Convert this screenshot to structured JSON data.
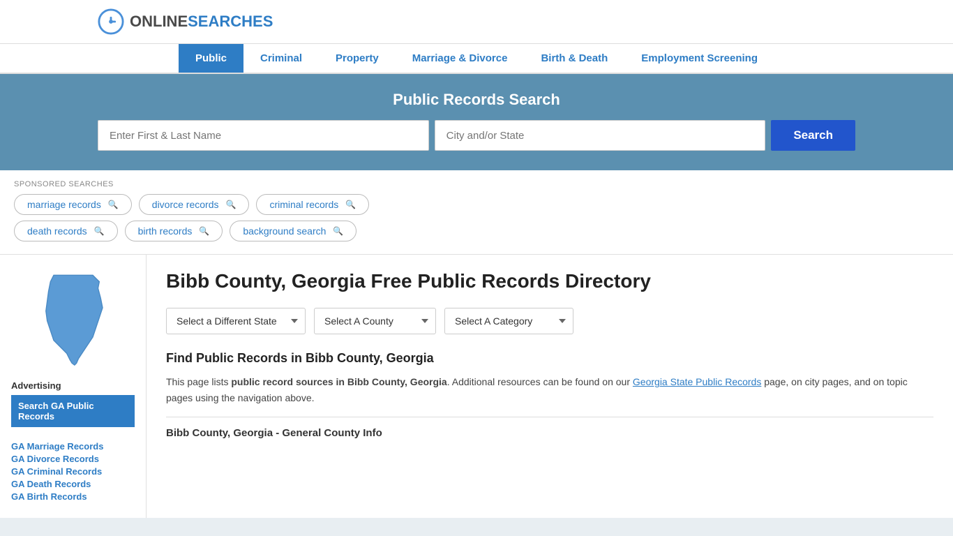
{
  "site": {
    "logo_online": "ONLINE",
    "logo_searches": "SEARCHES"
  },
  "nav": {
    "items": [
      {
        "label": "Public",
        "active": true
      },
      {
        "label": "Criminal",
        "active": false
      },
      {
        "label": "Property",
        "active": false
      },
      {
        "label": "Marriage & Divorce",
        "active": false
      },
      {
        "label": "Birth & Death",
        "active": false
      },
      {
        "label": "Employment Screening",
        "active": false
      }
    ]
  },
  "search_banner": {
    "title": "Public Records Search",
    "name_placeholder": "Enter First & Last Name",
    "location_placeholder": "City and/or State",
    "button_label": "Search"
  },
  "sponsored": {
    "label": "SPONSORED SEARCHES",
    "tags": [
      "marriage records",
      "divorce records",
      "criminal records",
      "death records",
      "birth records",
      "background search"
    ]
  },
  "page": {
    "title": "Bibb County, Georgia Free Public Records Directory",
    "dropdowns": {
      "state_label": "Select a Different State",
      "county_label": "Select A County",
      "category_label": "Select A Category"
    },
    "find_title": "Find Public Records in Bibb County, Georgia",
    "description_part1": "This page lists ",
    "description_bold": "public record sources in Bibb County, Georgia",
    "description_part2": ". Additional resources can be found on our ",
    "description_link": "Georgia State Public Records",
    "description_part3": " page, on city pages, and on topic pages using the navigation above.",
    "county_info_title": "Bibb County, Georgia - General County Info"
  },
  "sidebar": {
    "ad_label": "Advertising",
    "ad_item": "Search GA Public Records",
    "links": [
      "GA Marriage Records",
      "GA Divorce Records",
      "GA Criminal Records",
      "GA Death Records",
      "GA Birth Records"
    ]
  },
  "colors": {
    "blue_dark": "#2255cc",
    "blue_mid": "#2e7dc5",
    "blue_banner": "#5b90b0",
    "blue_sidebar_bg": "#2e7dc5"
  }
}
